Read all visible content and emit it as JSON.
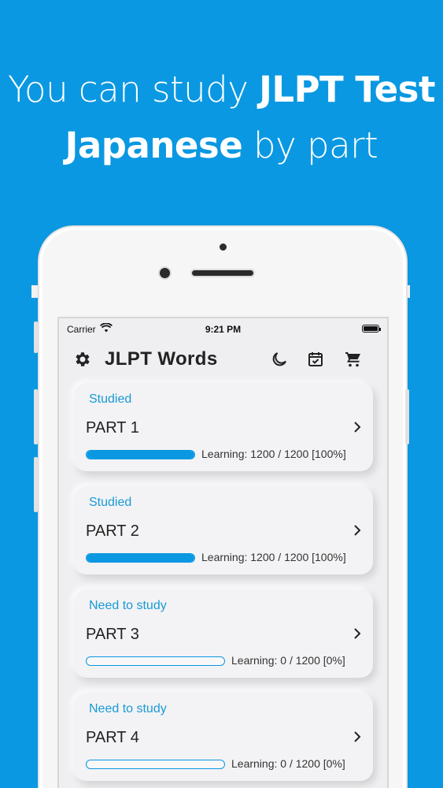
{
  "headline": {
    "line1_light": "You can study ",
    "line1_bold": "JLPT Test",
    "line2_bold": "Japanese",
    "line2_light": " by part"
  },
  "statusbar": {
    "carrier": "Carrier",
    "time": "9:21 PM"
  },
  "navbar": {
    "title": "JLPT Words",
    "icons": [
      "gear-icon",
      "moon-icon",
      "calendar-check-icon",
      "cart-icon"
    ]
  },
  "colors": {
    "background": "#0a98e2",
    "accent": "#1a9ad6",
    "card": "#f3f3f5"
  },
  "parts": [
    {
      "status": "Studied",
      "name": "PART 1",
      "learning": "Learning: 1200 / 1200 [100%]",
      "progress": 1.0
    },
    {
      "status": "Studied",
      "name": "PART 2",
      "learning": "Learning: 1200 / 1200 [100%]",
      "progress": 1.0
    },
    {
      "status": "Need to study",
      "name": "PART 3",
      "learning": "Learning: 0 / 1200 [0%]",
      "progress": 0.0
    },
    {
      "status": "Need to study",
      "name": "PART 4",
      "learning": "Learning: 0 / 1200 [0%]",
      "progress": 0.0
    }
  ]
}
